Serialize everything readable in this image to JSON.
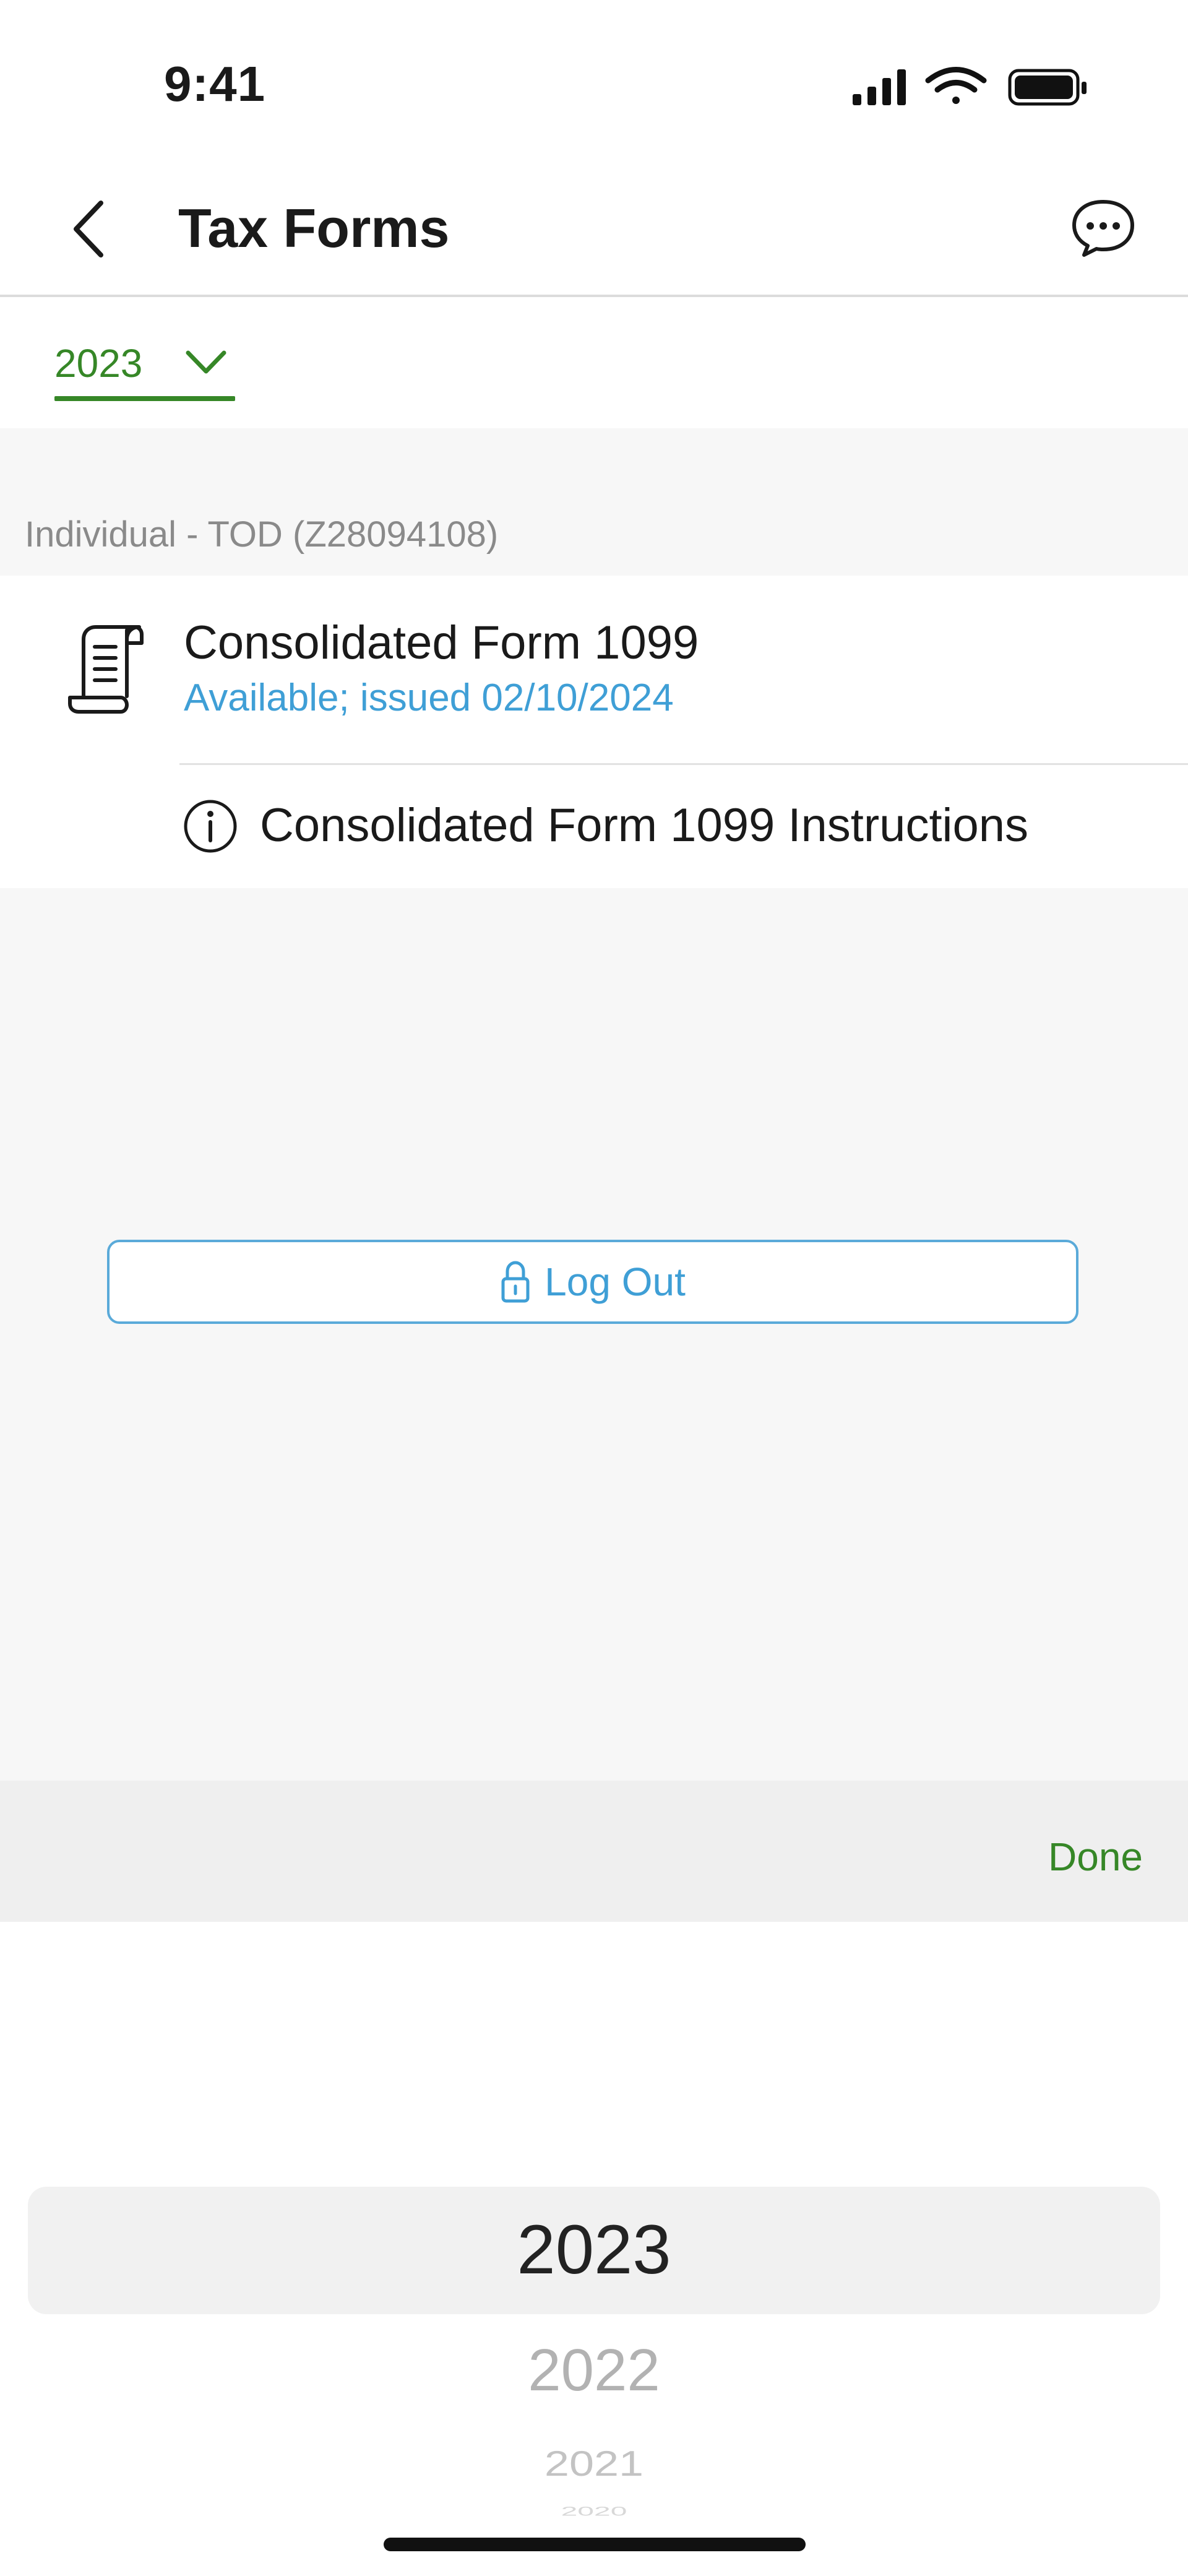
{
  "status_bar": {
    "time": "9:41",
    "icons": [
      "cellular-signal-icon",
      "wifi-icon",
      "battery-icon"
    ]
  },
  "nav": {
    "title": "Tax Forms",
    "back_icon": "chevron-left-icon",
    "chat_icon": "chat-bubble-icon"
  },
  "year_selector": {
    "value": "2023",
    "icon": "chevron-down-icon"
  },
  "account": {
    "label": "Individual - TOD (Z28094108)"
  },
  "forms": [
    {
      "title": "Consolidated Form 1099",
      "status": "Available; issued 02/10/2024",
      "icon": "document-scroll-icon"
    }
  ],
  "instructions": {
    "label": "Consolidated Form 1099 Instructions",
    "icon": "info-circle-icon"
  },
  "logout": {
    "label": "Log Out",
    "icon": "lock-icon"
  },
  "picker": {
    "done_label": "Done",
    "options": [
      "2023",
      "2022",
      "2021",
      "2020"
    ],
    "selected": "2023"
  },
  "colors": {
    "accent_green": "#368727",
    "link_blue": "#3f9fd6",
    "background_gray": "#f7f7f7"
  }
}
